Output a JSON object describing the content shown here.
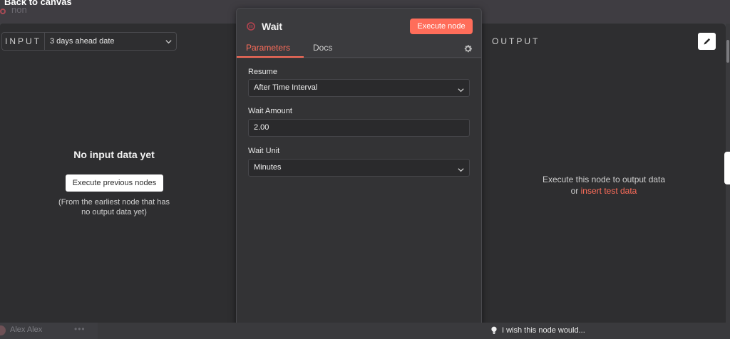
{
  "app": {
    "back_label": "Back to canvas",
    "bg_title": "non"
  },
  "input_panel": {
    "label": "INPUT",
    "selected_node": "3 days ahead date",
    "empty_title": "No input data yet",
    "execute_previous_label": "Execute previous nodes",
    "hint_line1": "(From the earliest node that has",
    "hint_line2": "no output data yet)"
  },
  "node": {
    "title": "Wait",
    "execute_label": "Execute node",
    "tabs": [
      {
        "label": "Parameters",
        "active": true
      },
      {
        "label": "Docs",
        "active": false
      }
    ],
    "fields": [
      {
        "label": "Resume",
        "value": "After Time Interval",
        "type": "select"
      },
      {
        "label": "Wait Amount",
        "value": "2.00",
        "type": "number"
      },
      {
        "label": "Wait Unit",
        "value": "Minutes",
        "type": "select"
      }
    ]
  },
  "output_panel": {
    "label": "OUTPUT",
    "message": "Execute this node to output data",
    "or_text": "or",
    "link_text": "insert test data"
  },
  "footer": {
    "user_name": "Alex Alex",
    "menu_dots": "•••",
    "feedback_text": "I wish this node would..."
  },
  "colors": {
    "accent": "#ff6d5a",
    "panel_bg": "#2e2e30",
    "node_panel_bg": "#3b3b3e"
  },
  "icons": [
    "chevron-down-icon",
    "wait-node-icon",
    "gear-icon",
    "pencil-icon",
    "lightbulb-icon"
  ]
}
